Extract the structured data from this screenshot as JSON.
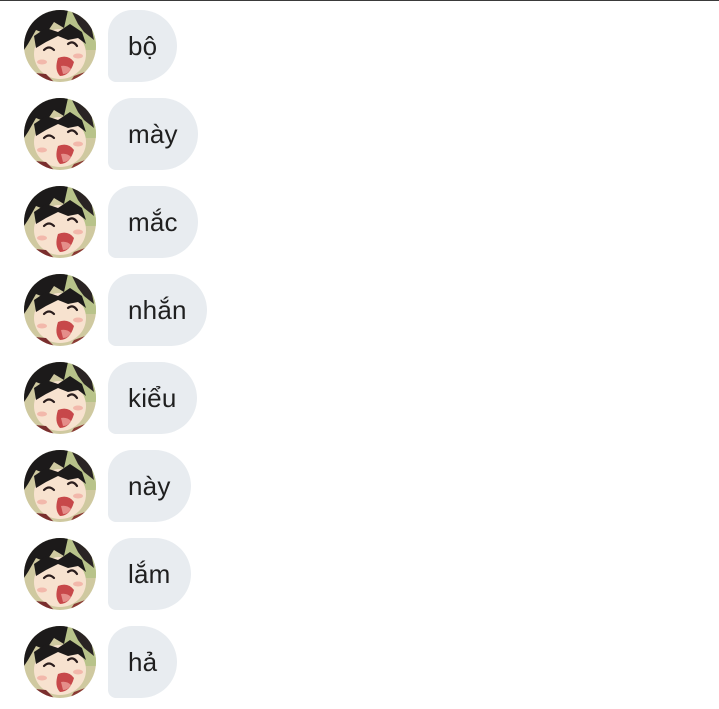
{
  "messages": [
    {
      "text": "bộ"
    },
    {
      "text": "mày"
    },
    {
      "text": "mắc"
    },
    {
      "text": "nhắn"
    },
    {
      "text": "kiểu"
    },
    {
      "text": "này"
    },
    {
      "text": "lắm"
    },
    {
      "text": "hả"
    }
  ],
  "colors": {
    "bubble_bg": "#e8ecf0",
    "text": "#1f1f1f",
    "top_rule": "#3a3a3a"
  },
  "icons": {
    "avatar": "laughing-anime-avatar"
  }
}
